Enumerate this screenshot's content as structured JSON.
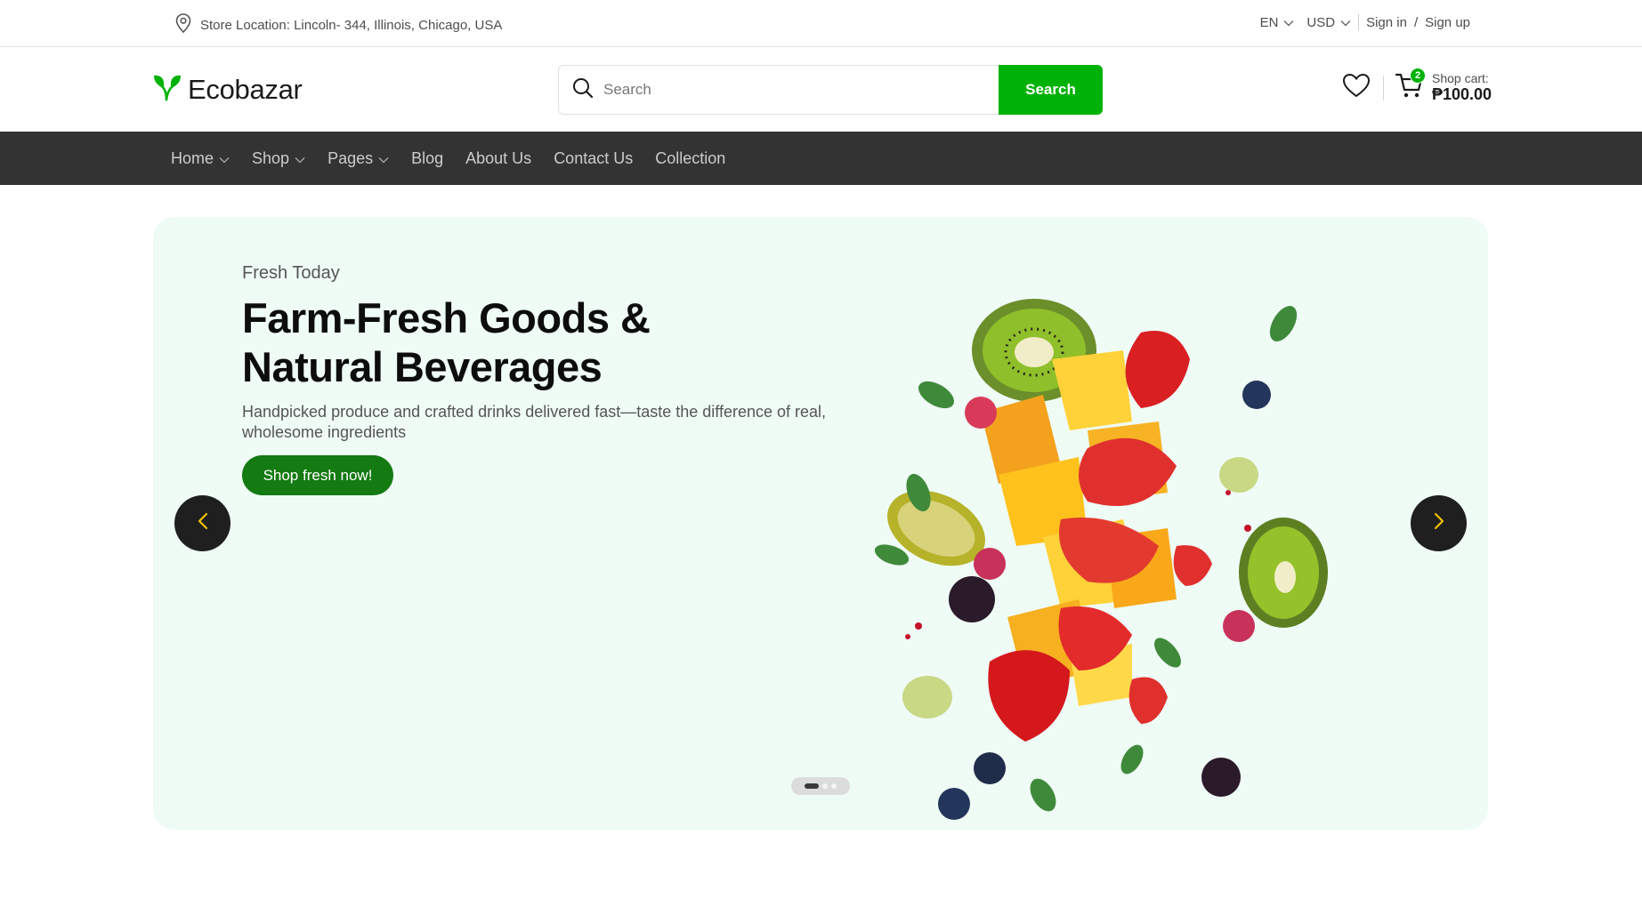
{
  "topbar": {
    "location_icon": "map-pin-icon",
    "location": "Store Location: Lincoln- 344, Illinois, Chicago, USA",
    "language": "EN",
    "currency": "USD",
    "sign_in": "Sign in",
    "divider": "/",
    "sign_up": "Sign up"
  },
  "header": {
    "logo_text": "Ecobazar",
    "logo_color": "#00b207",
    "search_placeholder": "Search",
    "search_button": "Search",
    "cart_count": "2",
    "cart_label": "Shop cart:",
    "cart_total": "₱100.00"
  },
  "nav": {
    "items": [
      {
        "label": "Home",
        "has_dropdown": true
      },
      {
        "label": "Shop",
        "has_dropdown": true
      },
      {
        "label": "Pages",
        "has_dropdown": true
      },
      {
        "label": "Blog",
        "has_dropdown": false
      },
      {
        "label": "About Us",
        "has_dropdown": false
      },
      {
        "label": "Contact Us",
        "has_dropdown": false
      },
      {
        "label": "Collection",
        "has_dropdown": false
      }
    ]
  },
  "hero": {
    "eyebrow": "Fresh Today",
    "title_line1": "Farm-Fresh Goods &",
    "title_line2": "Natural Beverages",
    "description": "Handpicked produce and crafted drinks delivered fast—taste the difference of real, wholesome ingredients",
    "cta": "Shop fresh now!",
    "slide_count": 3,
    "active_slide": 1,
    "image": "fruit-splash-image"
  },
  "colors": {
    "brand_green": "#00b207",
    "cta_green": "#147a12",
    "nav_bg": "#333333",
    "hero_bg": "#effbf5",
    "arrow_icon": "#f2c200"
  }
}
